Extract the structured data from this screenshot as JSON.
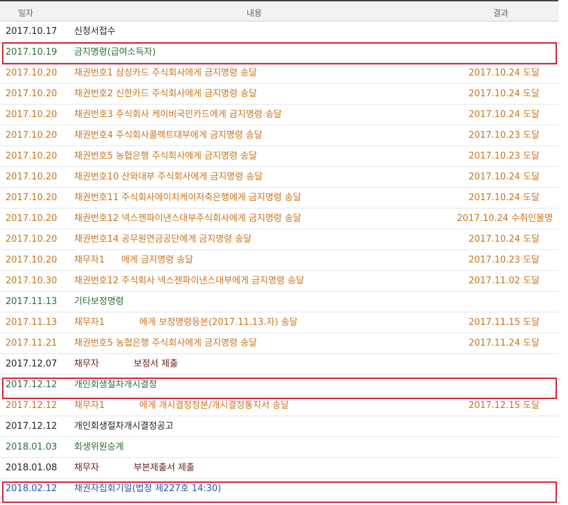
{
  "header": {
    "date": "일자",
    "content": "내용",
    "result": "결과"
  },
  "rows": [
    {
      "date": "2017.10.17",
      "content": "신청서접수",
      "result": ""
    },
    {
      "date": "2017.10.19",
      "content": "금지명령(급여소득자)",
      "result": ""
    },
    {
      "date": "2017.10.20",
      "content": "채권번호1 삼성카드 주식회사에게 금지명령 송달",
      "result": "2017.10.24 도달"
    },
    {
      "date": "2017.10.20",
      "content": "채권번호2 신한카드 주식회사에게 금지명령 송달",
      "result": "2017.10.24 도달"
    },
    {
      "date": "2017.10.20",
      "content": "채권번호3 주식회사 케이비국민카드에게 금지명령 송달",
      "result": "2017.10.24 도달"
    },
    {
      "date": "2017.10.20",
      "content": "채권번호4 주식회사콜렉트대부에게 금지명령 송달",
      "result": "2017.10.23 도달"
    },
    {
      "date": "2017.10.20",
      "content": "채권번호5 농협은행 주식회사에게 금지명령 송달",
      "result": "2017.10.23 도달"
    },
    {
      "date": "2017.10.20",
      "content": "채권번호10 산와대부 주식회사에게 금지명령 송달",
      "result": "2017.10.24 도달"
    },
    {
      "date": "2017.10.20",
      "content": "채권번호11 주식회사에이치케이저축은행에게 금지명령 송달",
      "result": "2017.10.24 도달"
    },
    {
      "date": "2017.10.20",
      "content": "채권번호12 넥스젠파이낸스대부주식회사에게 금지명령 송달",
      "result": "2017.10.24 수취인불명"
    },
    {
      "date": "2017.10.20",
      "content": "채권번호14 공무원연금공단에게 금지명령 송달",
      "result": "2017.10.24 도달"
    },
    {
      "date": "2017.10.20",
      "content_a": "채무자1",
      "content_b": "에게 금지명령 송달",
      "result": "2017.10.23 도달"
    },
    {
      "date": "2017.10.30",
      "content": "채권번호12 주식회사 넥스젠파이낸스대부에게 금지명령 송달",
      "result": "2017.11.02 도달"
    },
    {
      "date": "2017.11.13",
      "content": "기타보정명령",
      "result": ""
    },
    {
      "date": "2017.11.13",
      "content_a": "채무자1",
      "content_b": "에게 보정명령등본(2017.11.13.자) 송달",
      "result": "2017.11.15 도달"
    },
    {
      "date": "2017.11.21",
      "content": "채권번호5 농협은행 주식회사에게 금지명령 송달",
      "result": "2017.11.24 도달"
    },
    {
      "date": "2017.12.07",
      "content_a": "채무자",
      "content_b": "보정서 제출",
      "result": ""
    },
    {
      "date": "2017.12.12",
      "content": "개인회생절차개시결정",
      "result": ""
    },
    {
      "date": "2017.12.12",
      "content_a": "채무자1",
      "content_b": "에게 개시결정정본/개시결정통지서 송달",
      "result": "2017.12.15 도달"
    },
    {
      "date": "2017.12.12",
      "content": "개인회생절차개시결정공고",
      "result": ""
    },
    {
      "date": "2018.01.03",
      "content": "회생위원승계",
      "result": ""
    },
    {
      "date": "2018.01.08",
      "content_a": "채무자",
      "content_b": "부본제출서 제출",
      "result": ""
    },
    {
      "date": "2018.02.12",
      "content": "채권자집회기일(법정 제227호 14:30)",
      "result": ""
    }
  ],
  "colors": {
    "highlight": "#d7223a",
    "orange": "#c9741c",
    "green": "#2c6e3f",
    "blue": "#2458a6"
  }
}
